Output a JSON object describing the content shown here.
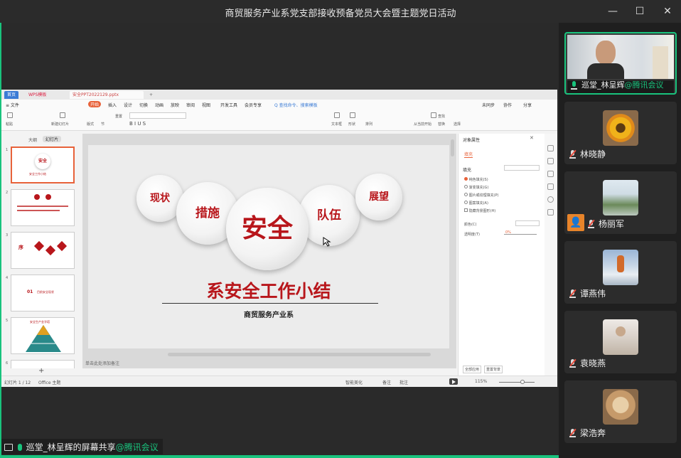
{
  "window": {
    "title": "商贸服务产业系党支部接收预备党员大会暨主题党日活动",
    "minimize": "—",
    "maximize": "☐",
    "close": "✕"
  },
  "wps": {
    "tabs": [
      "首页",
      "WPS模板",
      "安全PPT2022129.pptx"
    ],
    "menus": [
      "≡ 文件",
      "开始",
      "插入",
      "设计",
      "切换",
      "动画",
      "放映",
      "审阅",
      "视图",
      "开发工具",
      "会员专享"
    ],
    "search": "Q 查找命令、搜索模板",
    "right_actions": [
      "未同步",
      "协作",
      "分享"
    ],
    "ribbon": {
      "paste": "粘贴",
      "new_slide": "新建幻灯片",
      "layout": "版式",
      "section": "节",
      "reset": "重置",
      "textbox": "文本框",
      "shape": "形状",
      "arrange": "排列",
      "find": "查找",
      "replace": "替换",
      "select": "选择",
      "play": "从当前开始"
    },
    "thumb_tabs": [
      "大纲",
      "幻灯片"
    ],
    "thumb_numbers": [
      "1",
      "2",
      "3",
      "4",
      "5",
      "6"
    ],
    "thumb_texts": {
      "t1_title": "安全",
      "t1_sub": "安全工作小结",
      "t3_badge": "序",
      "t4_num": "01",
      "t4_text": "目前安全现状",
      "t5_title": "安全生产金字塔"
    },
    "add_slide": "+",
    "notes_hint": "单击此处添加备注",
    "slide": {
      "bubbles": [
        "现状",
        "措施",
        "安全",
        "队伍",
        "展望"
      ],
      "title": "系安全工作小结",
      "subtitle": "商贸服务产业系"
    },
    "props": {
      "title": "对象属性",
      "tab": "填充",
      "fill": "填充",
      "options": [
        "纯色填充(S)",
        "渐变填充(G)",
        "图片或纹理填充(P)",
        "图案填充(A)",
        "隐藏背景图形(H)"
      ],
      "color_label": "颜色(C)",
      "transparency_label": "透明度(T)",
      "transparency_value": "0%",
      "apply_all": "全部应用",
      "reset_bg": "重置背景"
    },
    "status": {
      "slide_index": "幻灯片 1 / 12",
      "theme": "Office 主题",
      "smart_beautify": "智能美化",
      "notes": "备注",
      "comments": "批注",
      "zoom": "115%"
    }
  },
  "participants": [
    {
      "name": "巡堂_林呈辉",
      "tag": "@腾讯会议",
      "mic": "on",
      "active": true
    },
    {
      "name": "林晓静",
      "mic": "muted"
    },
    {
      "name": "杨丽军",
      "mic": "muted"
    },
    {
      "name": "谭燕伟",
      "mic": "muted"
    },
    {
      "name": "袁晓燕",
      "mic": "muted"
    },
    {
      "name": "梁浩奔",
      "mic": "muted"
    }
  ],
  "share_label": {
    "text": "巡堂_林呈辉的屏幕共享",
    "tag": "@腾讯会议"
  },
  "colors": {
    "accent_green": "#19c37d",
    "slide_red": "#b8161b",
    "wps_orange": "#e8623a"
  }
}
